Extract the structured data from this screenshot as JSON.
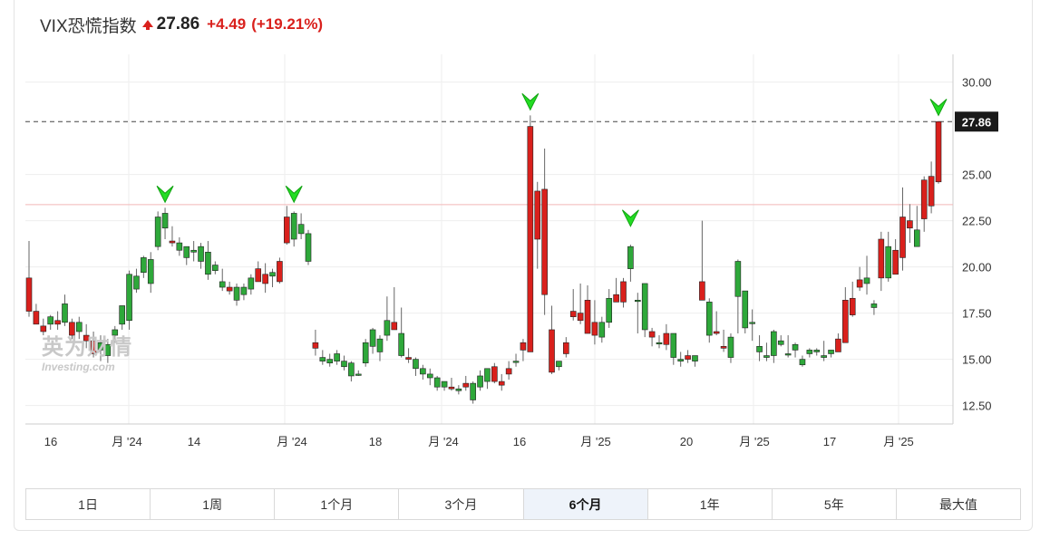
{
  "header": {
    "title": "VIX恐慌指数",
    "price": "27.86",
    "change": "+4.49",
    "change_pct": "(+19.21%)",
    "direction_icon": "arrow-up-icon",
    "up_color": "#d9201c"
  },
  "watermark": {
    "main": "英为财情",
    "sub": "Investing.com"
  },
  "ranges": [
    {
      "label": "1日",
      "active": false
    },
    {
      "label": "1周",
      "active": false
    },
    {
      "label": "1个月",
      "active": false
    },
    {
      "label": "3个月",
      "active": false
    },
    {
      "label": "6个月",
      "active": true
    },
    {
      "label": "1年",
      "active": false
    },
    {
      "label": "5年",
      "active": false
    },
    {
      "label": "最大值",
      "active": false
    }
  ],
  "chart_data": {
    "type": "candlestick",
    "y_ticks": [
      "30.00",
      "25.00",
      "22.50",
      "20.00",
      "17.50",
      "15.00",
      "12.50"
    ],
    "ylim": [
      11.5,
      31.5
    ],
    "current_label": "27.86",
    "current_value": 27.86,
    "reference_level": 23.37,
    "x_tick_labels": [
      "16",
      "月 '24",
      "14",
      "月 '24",
      "18",
      "月 '24",
      "16",
      "月 '25",
      "20",
      "月 '25",
      "17",
      "月 '25"
    ],
    "up_color": "#2ea83a",
    "down_color": "#d9201c",
    "marker_icon": "green-arrow-marker-icon",
    "marker_color": "#22dd22",
    "candles": [
      [
        19.4,
        21.4,
        17.3,
        17.6
      ],
      [
        17.6,
        18.0,
        16.9,
        16.9
      ],
      [
        16.8,
        17.2,
        16.3,
        16.5
      ],
      [
        16.9,
        17.4,
        16.6,
        17.3
      ],
      [
        17.1,
        17.6,
        16.6,
        16.9
      ],
      [
        17.0,
        18.5,
        16.8,
        18.0
      ],
      [
        17.0,
        17.2,
        16.1,
        16.3
      ],
      [
        16.5,
        17.3,
        16.1,
        17.0
      ],
      [
        16.3,
        16.9,
        15.6,
        16.0
      ],
      [
        16.0,
        16.5,
        15.1,
        15.3
      ],
      [
        15.5,
        16.3,
        14.9,
        15.9
      ],
      [
        15.2,
        16.1,
        14.8,
        15.8
      ],
      [
        16.3,
        16.8,
        15.9,
        16.6
      ],
      [
        16.9,
        17.9,
        16.6,
        17.9
      ],
      [
        17.1,
        19.8,
        16.6,
        19.6
      ],
      [
        18.8,
        19.9,
        18.6,
        19.5
      ],
      [
        19.7,
        20.6,
        19.4,
        20.5
      ],
      [
        19.1,
        20.8,
        18.6,
        20.4
      ],
      [
        21.1,
        23.0,
        20.9,
        22.7
      ],
      [
        22.1,
        23.2,
        21.5,
        22.9
      ],
      [
        21.4,
        22.2,
        21.1,
        21.3
      ],
      [
        20.9,
        21.6,
        20.6,
        21.3
      ],
      [
        20.5,
        21.1,
        20.1,
        21.1
      ],
      [
        20.8,
        21.4,
        20.3,
        20.9
      ],
      [
        20.3,
        21.3,
        19.9,
        21.1
      ],
      [
        19.6,
        21.4,
        19.3,
        20.8
      ],
      [
        19.8,
        20.3,
        19.6,
        20.1
      ],
      [
        18.9,
        19.9,
        18.7,
        19.2
      ],
      [
        18.9,
        19.2,
        18.5,
        18.7
      ],
      [
        18.2,
        19.1,
        17.9,
        18.9
      ],
      [
        18.5,
        19.1,
        18.2,
        18.9
      ],
      [
        18.8,
        19.6,
        18.5,
        19.4
      ],
      [
        19.9,
        20.3,
        19.4,
        19.2
      ],
      [
        19.6,
        20.2,
        18.6,
        19.1
      ],
      [
        19.5,
        19.9,
        18.9,
        19.7
      ],
      [
        20.3,
        20.5,
        19.1,
        19.2
      ],
      [
        22.7,
        23.3,
        21.2,
        21.3
      ],
      [
        21.5,
        23.0,
        21.1,
        22.9
      ],
      [
        21.8,
        22.9,
        21.5,
        22.3
      ],
      [
        20.3,
        22.0,
        20.1,
        21.8
      ],
      [
        15.9,
        16.6,
        15.2,
        15.6
      ],
      [
        14.9,
        15.5,
        14.7,
        15.1
      ],
      [
        14.8,
        15.3,
        14.6,
        15.0
      ],
      [
        14.9,
        15.5,
        14.7,
        15.3
      ],
      [
        14.6,
        15.2,
        14.4,
        14.9
      ],
      [
        14.1,
        14.9,
        13.8,
        14.8
      ],
      [
        14.2,
        14.4,
        14.1,
        14.2
      ],
      [
        14.8,
        16.1,
        14.6,
        15.9
      ],
      [
        15.7,
        16.7,
        15.3,
        16.6
      ],
      [
        15.4,
        16.3,
        14.9,
        16.1
      ],
      [
        16.3,
        18.4,
        16.0,
        17.1
      ],
      [
        17.0,
        18.9,
        16.6,
        16.6
      ],
      [
        15.2,
        17.8,
        15.1,
        16.4
      ],
      [
        15.1,
        15.6,
        14.8,
        15.0
      ],
      [
        14.5,
        15.1,
        14.1,
        15.0
      ],
      [
        14.2,
        14.7,
        13.9,
        14.5
      ],
      [
        14.0,
        14.5,
        13.6,
        14.2
      ],
      [
        13.5,
        14.1,
        13.3,
        14.0
      ],
      [
        13.5,
        13.8,
        13.3,
        13.8
      ],
      [
        13.5,
        14.0,
        13.3,
        13.4
      ],
      [
        13.3,
        13.6,
        13.1,
        13.4
      ],
      [
        13.7,
        14.1,
        13.3,
        13.5
      ],
      [
        12.8,
        13.8,
        12.6,
        13.7
      ],
      [
        13.5,
        14.4,
        13.3,
        14.1
      ],
      [
        13.8,
        14.5,
        13.4,
        14.5
      ],
      [
        14.6,
        14.8,
        13.7,
        13.8
      ],
      [
        13.8,
        14.2,
        13.3,
        13.6
      ],
      [
        14.5,
        14.9,
        13.9,
        14.2
      ],
      [
        14.9,
        15.3,
        14.6,
        14.9
      ],
      [
        15.9,
        16.1,
        14.9,
        15.5
      ],
      [
        27.6,
        28.2,
        15.5,
        15.4
      ],
      [
        24.1,
        24.6,
        19.9,
        21.5
      ],
      [
        24.2,
        26.4,
        17.4,
        18.5
      ],
      [
        16.6,
        17.9,
        14.2,
        14.3
      ],
      [
        14.6,
        14.9,
        14.4,
        14.9
      ],
      [
        15.9,
        16.2,
        15.1,
        15.3
      ],
      [
        17.6,
        18.8,
        17.1,
        17.3
      ],
      [
        17.5,
        19.1,
        16.9,
        17.1
      ],
      [
        18.2,
        19.0,
        16.4,
        16.4
      ],
      [
        17.0,
        18.2,
        15.8,
        16.3
      ],
      [
        16.2,
        17.3,
        15.9,
        17.0
      ],
      [
        17.0,
        18.8,
        16.7,
        18.3
      ],
      [
        18.5,
        19.4,
        18.2,
        18.1
      ],
      [
        19.2,
        19.4,
        17.8,
        18.1
      ],
      [
        19.9,
        21.2,
        19.2,
        21.1
      ],
      [
        18.2,
        18.6,
        16.4,
        18.2
      ],
      [
        16.6,
        19.1,
        16.2,
        19.1
      ],
      [
        16.5,
        16.7,
        15.7,
        16.2
      ],
      [
        15.9,
        16.3,
        15.6,
        15.9
      ],
      [
        16.4,
        16.9,
        15.5,
        15.8
      ],
      [
        15.1,
        16.4,
        14.7,
        16.4
      ],
      [
        14.9,
        15.4,
        14.6,
        15.0
      ],
      [
        15.2,
        15.5,
        14.8,
        15.0
      ],
      [
        14.9,
        15.2,
        14.6,
        15.2
      ],
      [
        19.2,
        22.5,
        18.3,
        18.2
      ],
      [
        16.3,
        18.3,
        15.9,
        18.1
      ],
      [
        16.5,
        17.6,
        16.3,
        16.4
      ],
      [
        15.7,
        16.6,
        15.4,
        15.6
      ],
      [
        15.1,
        16.4,
        14.8,
        16.2
      ],
      [
        18.4,
        20.4,
        16.4,
        20.3
      ],
      [
        16.7,
        18.5,
        16.4,
        18.7
      ],
      [
        17.0,
        17.7,
        16.0,
        17.0
      ],
      [
        15.4,
        16.3,
        14.9,
        15.7
      ],
      [
        15.1,
        15.9,
        14.9,
        15.2
      ],
      [
        15.2,
        16.6,
        14.8,
        16.5
      ],
      [
        15.8,
        16.3,
        15.7,
        16.0
      ],
      [
        15.3,
        16.3,
        15.1,
        15.3
      ],
      [
        15.5,
        15.9,
        15.1,
        15.8
      ],
      [
        14.7,
        15.2,
        14.6,
        15.0
      ],
      [
        15.3,
        15.6,
        15.1,
        15.5
      ],
      [
        15.4,
        15.6,
        15.2,
        15.5
      ],
      [
        15.1,
        16.0,
        14.9,
        15.2
      ],
      [
        15.3,
        15.5,
        15.1,
        15.5
      ],
      [
        16.1,
        16.4,
        15.5,
        15.4
      ],
      [
        18.2,
        18.9,
        16.5,
        15.9
      ],
      [
        18.3,
        19.2,
        17.3,
        17.4
      ],
      [
        19.3,
        20.0,
        18.7,
        18.9
      ],
      [
        19.1,
        20.6,
        18.5,
        19.4
      ],
      [
        17.8,
        18.2,
        17.4,
        18.0
      ],
      [
        21.5,
        21.9,
        18.7,
        19.4
      ],
      [
        19.4,
        21.9,
        19.2,
        21.1
      ],
      [
        20.9,
        21.5,
        19.6,
        19.6
      ],
      [
        22.7,
        24.3,
        19.8,
        20.5
      ],
      [
        22.5,
        23.4,
        21.3,
        22.1
      ],
      [
        21.1,
        23.3,
        21.1,
        22.0
      ],
      [
        24.7,
        24.9,
        21.9,
        22.6
      ],
      [
        24.9,
        25.7,
        22.9,
        23.3
      ],
      [
        27.86,
        27.9,
        24.5,
        24.6
      ]
    ],
    "markers": [
      {
        "candle": 19,
        "value": 23.3
      },
      {
        "candle": 37,
        "value": 23.3
      },
      {
        "candle": 70,
        "value": 28.3
      },
      {
        "candle": 84,
        "value": 22.0
      },
      {
        "candle": 127,
        "value": 28.0
      }
    ]
  }
}
